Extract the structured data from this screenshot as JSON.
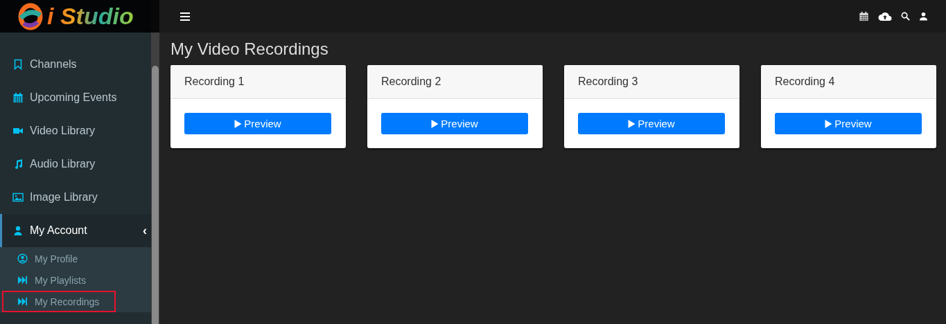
{
  "logo": {
    "text": "i Studio"
  },
  "sidebar": {
    "items": [
      {
        "label": "Channels",
        "kind": "bookmark",
        "expanded": false
      },
      {
        "label": "Upcoming Events",
        "kind": "calendar",
        "expanded": false
      },
      {
        "label": "Video Library",
        "kind": "video",
        "expanded": false
      },
      {
        "label": "Audio Library",
        "kind": "music",
        "expanded": false
      },
      {
        "label": "Image Library",
        "kind": "image",
        "expanded": false
      },
      {
        "label": "My Account",
        "kind": "user",
        "expanded": true,
        "caret": "‹",
        "children": [
          {
            "label": "My Profile",
            "kind": "profile",
            "selected": false
          },
          {
            "label": "My Playlists",
            "kind": "forward",
            "selected": false
          },
          {
            "label": "My Recordings",
            "kind": "forward",
            "selected": true
          }
        ]
      }
    ]
  },
  "title": "My Video Recordings",
  "recordings": [
    {
      "name": "Recording 1",
      "button": "Preview"
    },
    {
      "name": "Recording 2",
      "button": "Preview"
    },
    {
      "name": "Recording 3",
      "button": "Preview"
    },
    {
      "name": "Recording 4",
      "button": "Preview"
    }
  ]
}
